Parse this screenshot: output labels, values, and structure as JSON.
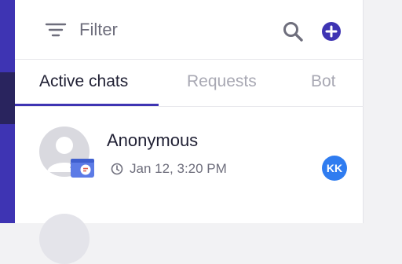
{
  "sidebar": {
    "expand_icon": "double-chevron-right-icon"
  },
  "header": {
    "filter_icon": "filter-lines-icon",
    "filter_label": "Filter",
    "search_icon": "search-icon",
    "add_icon": "plus-circle-icon"
  },
  "tabs": [
    {
      "label": "Active chats",
      "active": true
    },
    {
      "label": "Requests",
      "active": false
    },
    {
      "label": "Bot",
      "active": false
    }
  ],
  "chats": [
    {
      "name": "Anonymous",
      "time": "Jan 12, 3:20 PM",
      "agent_initials": "KK",
      "source_icon": "chat-widget-icon",
      "time_icon": "clock-icon"
    }
  ],
  "colors": {
    "brand": "#3e34b3",
    "agent_badge": "#2f7cf0",
    "muted_text": "#6e6e7c",
    "inactive_tab": "#a8a8b3"
  }
}
